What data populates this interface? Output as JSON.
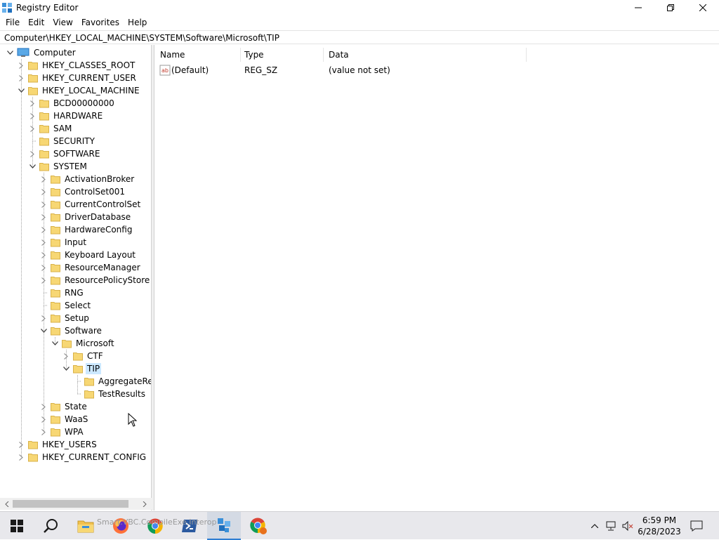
{
  "window": {
    "title": "Registry Editor"
  },
  "menu": [
    "File",
    "Edit",
    "View",
    "Favorites",
    "Help"
  ],
  "address": "Computer\\HKEY_LOCAL_MACHINE\\SYSTEM\\Software\\Microsoft\\TIP",
  "tree": [
    {
      "label": "Computer",
      "depth": 0,
      "expander": "expanded",
      "icon": "computer-icon"
    },
    {
      "label": "HKEY_CLASSES_ROOT",
      "depth": 1,
      "expander": "collapsed"
    },
    {
      "label": "HKEY_CURRENT_USER",
      "depth": 1,
      "expander": "collapsed"
    },
    {
      "label": "HKEY_LOCAL_MACHINE",
      "depth": 1,
      "expander": "expanded"
    },
    {
      "label": "BCD00000000",
      "depth": 2,
      "expander": "collapsed"
    },
    {
      "label": "HARDWARE",
      "depth": 2,
      "expander": "collapsed"
    },
    {
      "label": "SAM",
      "depth": 2,
      "expander": "collapsed"
    },
    {
      "label": "SECURITY",
      "depth": 2,
      "expander": "none"
    },
    {
      "label": "SOFTWARE",
      "depth": 2,
      "expander": "collapsed"
    },
    {
      "label": "SYSTEM",
      "depth": 2,
      "expander": "expanded"
    },
    {
      "label": "ActivationBroker",
      "depth": 3,
      "expander": "collapsed"
    },
    {
      "label": "ControlSet001",
      "depth": 3,
      "expander": "collapsed"
    },
    {
      "label": "CurrentControlSet",
      "depth": 3,
      "expander": "collapsed"
    },
    {
      "label": "DriverDatabase",
      "depth": 3,
      "expander": "collapsed"
    },
    {
      "label": "HardwareConfig",
      "depth": 3,
      "expander": "collapsed"
    },
    {
      "label": "Input",
      "depth": 3,
      "expander": "collapsed"
    },
    {
      "label": "Keyboard Layout",
      "depth": 3,
      "expander": "collapsed"
    },
    {
      "label": "ResourceManager",
      "depth": 3,
      "expander": "collapsed"
    },
    {
      "label": "ResourcePolicyStore",
      "depth": 3,
      "expander": "collapsed"
    },
    {
      "label": "RNG",
      "depth": 3,
      "expander": "none"
    },
    {
      "label": "Select",
      "depth": 3,
      "expander": "none"
    },
    {
      "label": "Setup",
      "depth": 3,
      "expander": "collapsed"
    },
    {
      "label": "Software",
      "depth": 3,
      "expander": "expanded"
    },
    {
      "label": "Microsoft",
      "depth": 4,
      "expander": "expanded"
    },
    {
      "label": "CTF",
      "depth": 5,
      "expander": "collapsed"
    },
    {
      "label": "TIP",
      "depth": 5,
      "expander": "expanded",
      "selected": true
    },
    {
      "label": "AggregateResults",
      "depth": 6,
      "expander": "none"
    },
    {
      "label": "TestResults",
      "depth": 6,
      "expander": "none"
    },
    {
      "label": "State",
      "depth": 3,
      "expander": "collapsed"
    },
    {
      "label": "WaaS",
      "depth": 3,
      "expander": "collapsed"
    },
    {
      "label": "WPA",
      "depth": 3,
      "expander": "collapsed"
    },
    {
      "label": "HKEY_USERS",
      "depth": 1,
      "expander": "collapsed"
    },
    {
      "label": "HKEY_CURRENT_CONFIG",
      "depth": 1,
      "expander": "collapsed"
    }
  ],
  "columns": [
    "Name",
    "Type",
    "Data"
  ],
  "values": [
    {
      "name": "(Default)",
      "type": "REG_SZ",
      "data": "(value not set)",
      "icon": "string-value-icon"
    }
  ],
  "taskbar": {
    "items": [
      {
        "name": "start-button",
        "icon": "windows-logo-icon"
      },
      {
        "name": "search-button",
        "icon": "search-icon"
      },
      {
        "name": "file-explorer-button",
        "icon": "folder-icon"
      },
      {
        "name": "firefox-button",
        "icon": "firefox-icon"
      },
      {
        "name": "chrome-button",
        "icon": "chrome-icon"
      },
      {
        "name": "powershell-button",
        "icon": "powershell-icon"
      },
      {
        "name": "registry-editor-button",
        "icon": "registry-editor-icon",
        "active": true
      },
      {
        "name": "chrome-profile-button",
        "icon": "chrome-icon"
      }
    ],
    "ghost_text": "Smart.VBC.CompileExe.Interop",
    "time": "6:59 PM",
    "date": "6/28/2023"
  },
  "colors": {
    "selection": "#cce8ff",
    "folder": "#f7d774",
    "accent": "#2d7dd2"
  }
}
